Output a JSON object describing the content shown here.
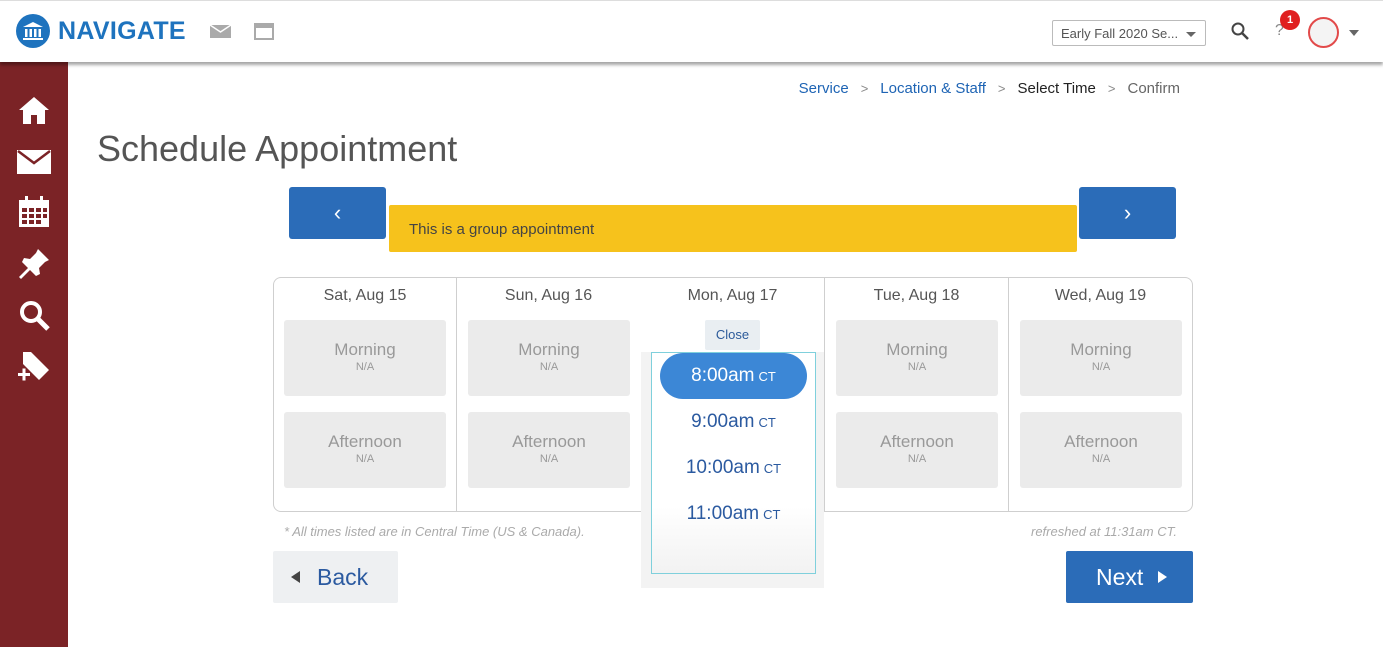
{
  "app": {
    "name": "NAVIGATE",
    "brand_color": "#1e73be",
    "sidebar_color": "#7b2326"
  },
  "header": {
    "term": "Early Fall 2020 Se...",
    "help_label": "?",
    "notification_count": "1"
  },
  "sidebar": {
    "items": [
      {
        "icon": "home-icon"
      },
      {
        "icon": "mail-icon"
      },
      {
        "icon": "calendar-icon"
      },
      {
        "icon": "pin-icon"
      },
      {
        "icon": "search-icon"
      },
      {
        "icon": "add-tag-icon"
      }
    ]
  },
  "breadcrumb": {
    "steps": [
      "Service",
      "Location & Staff",
      "Select Time",
      "Confirm"
    ],
    "separator": ">",
    "current_index": 2
  },
  "page": {
    "title": "Schedule Appointment",
    "banner": "This is a group appointment",
    "prev_label": "‹",
    "next_arrow_label": "›"
  },
  "days": [
    {
      "label": "Sat, Aug 15",
      "slots": [
        {
          "title": "Morning",
          "status": "N/A"
        },
        {
          "title": "Afternoon",
          "status": "N/A"
        }
      ]
    },
    {
      "label": "Sun, Aug 16",
      "slots": [
        {
          "title": "Morning",
          "status": "N/A"
        },
        {
          "title": "Afternoon",
          "status": "N/A"
        }
      ]
    },
    {
      "label": "Mon, Aug 17",
      "close_label": "Close",
      "times": [
        {
          "time": "8:00am",
          "tz": "CT",
          "selected": true
        },
        {
          "time": "9:00am",
          "tz": "CT"
        },
        {
          "time": "10:00am",
          "tz": "CT"
        },
        {
          "time": "11:00am",
          "tz": "CT"
        }
      ]
    },
    {
      "label": "Tue, Aug 18",
      "slots": [
        {
          "title": "Morning",
          "status": "N/A"
        },
        {
          "title": "Afternoon",
          "status": "N/A"
        }
      ]
    },
    {
      "label": "Wed, Aug 19",
      "slots": [
        {
          "title": "Morning",
          "status": "N/A"
        },
        {
          "title": "Afternoon",
          "status": "N/A"
        }
      ]
    }
  ],
  "footnotes": {
    "timezone": "* All times listed are in Central Time (US & Canada).",
    "refreshed": "refreshed at 11:31am CT."
  },
  "actions": {
    "back_label": "Back",
    "next_label": "Next"
  }
}
